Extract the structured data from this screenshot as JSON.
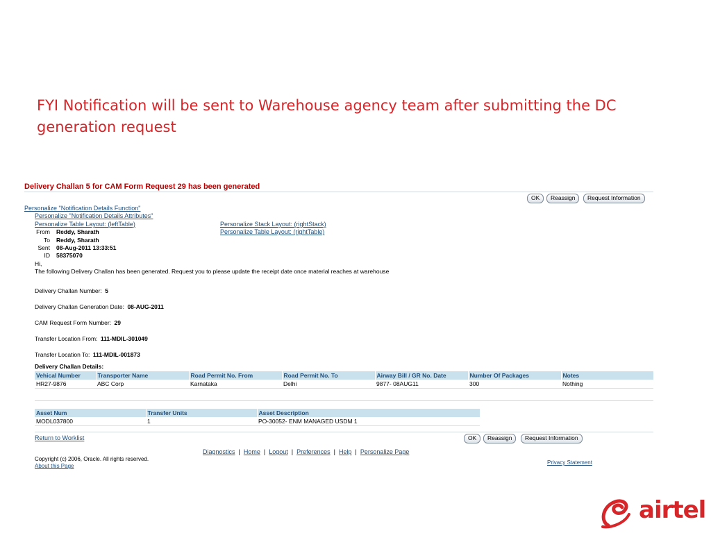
{
  "slide": {
    "title": "FYI Notification will be sent to Warehouse agency team after submitting the DC generation request",
    "logo_text": "airtel",
    "brand_color": "#d6262a"
  },
  "notification": {
    "header": "Delivery Challan 5 for CAM Form Request 29 has been generated",
    "buttons": {
      "ok": "OK",
      "reassign": "Reassign",
      "request_info": "Request Information"
    },
    "personalize": {
      "function": "Personalize \"Notification Details Function\"",
      "attributes": "Personalize \"Notification Details Attributes\"",
      "left_table": "Personalize Table Layout: (leftTable)",
      "right_stack": "Personalize Stack Layout: (rightStack)",
      "right_table": "Personalize Table Layout: (rightTable)"
    },
    "meta": {
      "from_label": "From",
      "from_value": "Reddy, Sharath",
      "to_label": "To",
      "to_value": "Reddy, Sharath",
      "sent_label": "Sent",
      "sent_value": "08-Aug-2011 13:33:51",
      "id_label": "ID",
      "id_value": "58375070"
    },
    "body": {
      "greeting": "Hi,",
      "message": "The following Delivery Challan has been generated. Request you to please update the receipt date once material reaches at warehouse",
      "dc_number_label": "Delivery Challan Number:",
      "dc_number": "5",
      "dc_date_label": "Delivery Challan Generation Date:",
      "dc_date": "08-AUG-2011",
      "cam_label": "CAM Request Form Number:",
      "cam_number": "29",
      "from_loc_label": "Transfer Location From:",
      "from_loc": "111-MDIL-301049",
      "to_loc_label": "Transfer Location To:",
      "to_loc": "111-MDIL-001873",
      "details_title": "Delivery Challan Details:"
    },
    "dc_table": {
      "headers": [
        "Vehical Number",
        "Transporter Name",
        "Road Permit No. From",
        "Road Permit No. To",
        "Airway Bill / GR No. Date",
        "Number Of Packages",
        "Notes"
      ],
      "rows": [
        [
          "HR27-9876",
          "ABC Corp",
          "Karnataka",
          "Delhi",
          "9877- 08AUG11",
          "300",
          "Nothing"
        ]
      ]
    },
    "asset_table": {
      "headers": [
        "Asset Num",
        "Transfer Units",
        "Asset Description"
      ],
      "rows": [
        [
          "MODL037800",
          "1",
          "PO-30052- ENM MANAGED USDM 1"
        ]
      ]
    },
    "return_link": "Return to Worklist",
    "footer": {
      "links": [
        "Diagnostics",
        "Home",
        "Logout",
        "Preferences",
        "Help",
        "Personalize Page"
      ],
      "copyright": "Copyright (c) 2006, Oracle. All rights reserved.",
      "about": "About this Page",
      "privacy": "Privacy Statement"
    }
  }
}
